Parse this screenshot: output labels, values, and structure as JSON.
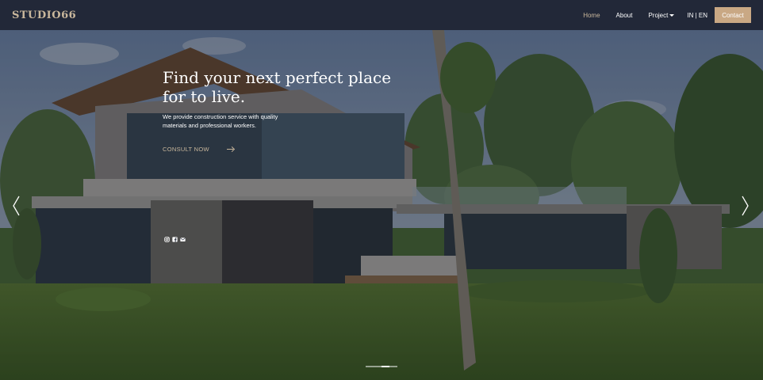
{
  "navbar": {
    "brand": "STUDIO66",
    "links": [
      {
        "label": "Home"
      },
      {
        "label": "About"
      },
      {
        "label": "Project"
      }
    ],
    "language": "IN | EN",
    "contact_label": "Contact"
  },
  "hero": {
    "title_line1": "Find your next perfect place",
    "title_line2": "for to live.",
    "description": "We provide construction service with quality materials and professional workers.",
    "cta_label": "CONSULT NOW",
    "social_icons": [
      "instagram-icon",
      "facebook-icon",
      "email-icon"
    ]
  },
  "carousel": {
    "slide_count": 3,
    "active_slide": 2
  },
  "colors": {
    "navbar_bg": "#222838",
    "brand": "#c9b79c",
    "active_link": "#c9b79c",
    "contact_button": "#c9a884"
  }
}
